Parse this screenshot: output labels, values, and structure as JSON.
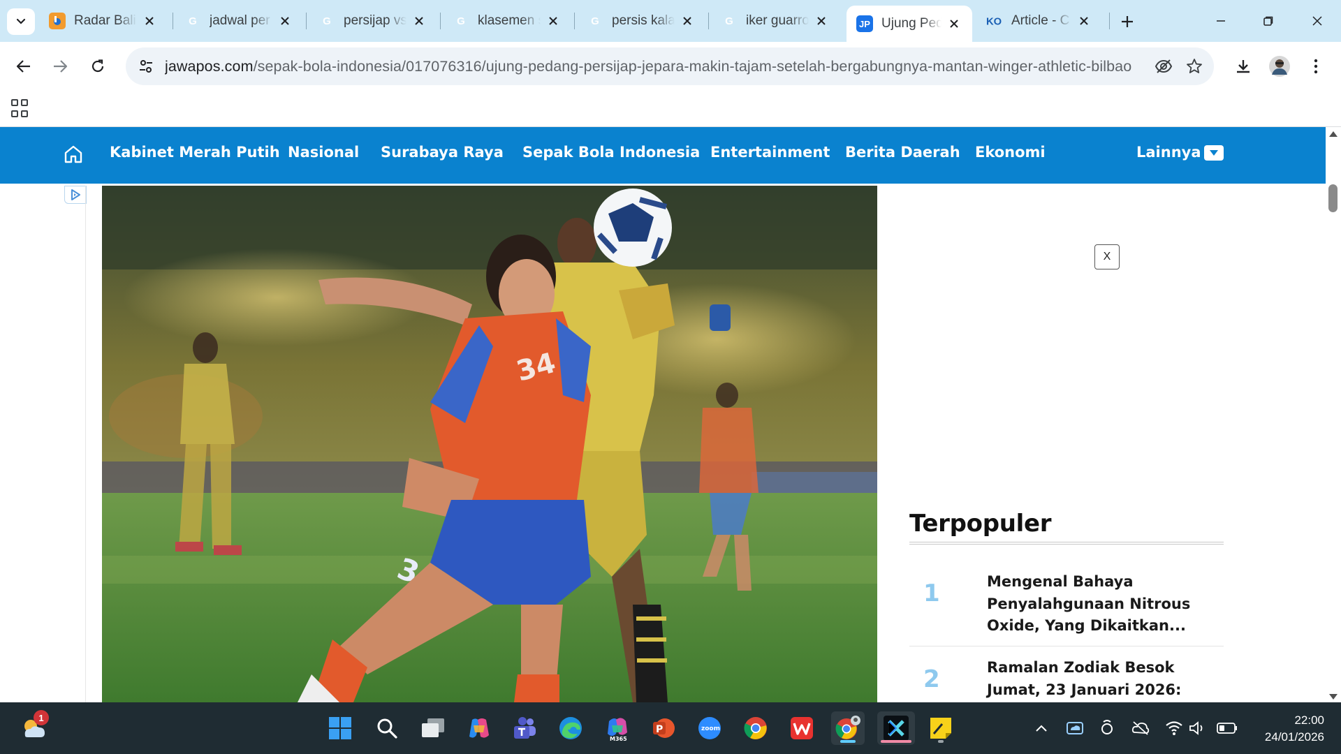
{
  "browser": {
    "tabs": [
      {
        "title": "Radar Bali",
        "icon": "radar-bali-icon",
        "color": "#f29b2e"
      },
      {
        "title": "jadwal per",
        "icon": "google-icon",
        "color": "#4285f4"
      },
      {
        "title": "persijap vs",
        "icon": "google-icon",
        "color": "#4285f4"
      },
      {
        "title": "klasemen s",
        "icon": "google-icon",
        "color": "#4285f4"
      },
      {
        "title": "persis kala",
        "icon": "google-icon",
        "color": "#4285f4"
      },
      {
        "title": "iker guarro",
        "icon": "google-icon",
        "color": "#4285f4"
      },
      {
        "title": "Ujung Ped",
        "icon": "jawapos-icon",
        "color": "#1a73e8",
        "active": true
      },
      {
        "title": "Article - C",
        "icon": "article-icon",
        "color": "#1a5fb4"
      }
    ],
    "url_domain": "jawapos.com",
    "url_path": "/sepak-bola-indonesia/017076316/ujung-pedang-persijap-jepara-makin-tajam-setelah-bergabungnya-mantan-winger-athletic-bilbao"
  },
  "site": {
    "nav": [
      "Kabinet Merah Putih",
      "Nasional",
      "Surabaya Raya",
      "Sepak Bola Indonesia",
      "Entertainment",
      "Berita Daerah",
      "Ekonomi"
    ],
    "more_label": "Lainnya",
    "brand_color": "#0a82cf"
  },
  "ad": {
    "close_label": "X"
  },
  "popular": {
    "heading": "Terpopuler",
    "items": [
      {
        "rank": "1",
        "lines": [
          "Mengenal Bahaya",
          "Penyalahgunaan Nitrous",
          "Oxide, Yang Dikaitkan..."
        ]
      },
      {
        "rank": "2",
        "lines": [
          "Ramalan Zodiak Besok",
          "Jumat, 23 Januari 2026:"
        ]
      }
    ]
  },
  "hero": {
    "jersey_number": "34"
  },
  "taskbar": {
    "weather_badge": "1",
    "time": "22:00",
    "date": "24/01/2026",
    "apps": [
      "windows-start-icon",
      "search-icon",
      "task-view-icon",
      "copilot-icon",
      "teams-icon",
      "edge-icon",
      "m365-icon",
      "powerpoint-icon",
      "zoom-icon",
      "chrome-icon",
      "wps-icon",
      "chrome-profile-icon",
      "capcut-icon",
      "sticky-notes-icon"
    ],
    "m365_label": "M365",
    "zoom_label": "zoom"
  }
}
